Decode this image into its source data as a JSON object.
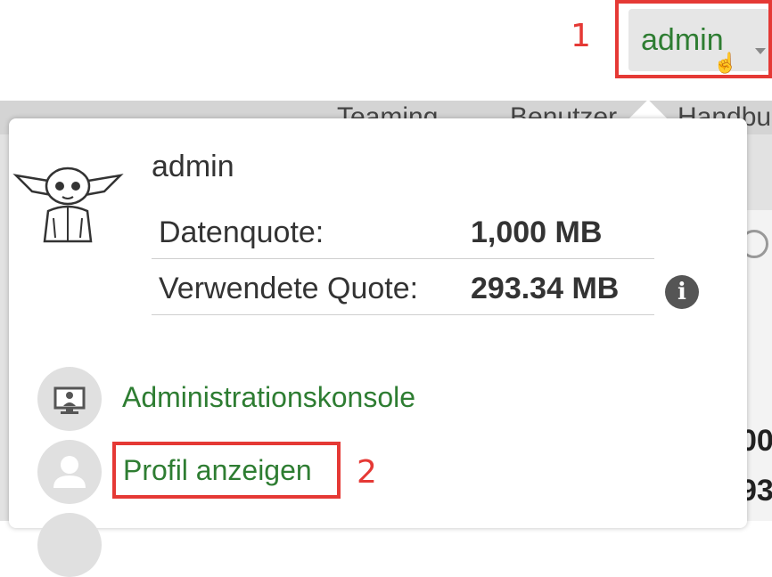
{
  "topbar": {
    "user_button_label": "admin"
  },
  "annotations": {
    "step1": "1",
    "step2": "2"
  },
  "background": {
    "tab_1": "Teaming",
    "tab_2": "Benutzer",
    "tab_3": "Handbuch",
    "right_row_1": "00",
    "right_row_2": "93"
  },
  "popup": {
    "username": "admin",
    "quota": [
      {
        "label": "Datenquote:",
        "value": "1,000 MB"
      },
      {
        "label": "Verwendete Quote:",
        "value": "293.34 MB"
      }
    ],
    "menu": [
      {
        "label": "Administrationskonsole",
        "icon": "monitor-icon"
      },
      {
        "label": "Profil anzeigen",
        "icon": "person-icon"
      }
    ]
  },
  "colors": {
    "link": "#2e7d32",
    "highlight": "#e53935"
  }
}
